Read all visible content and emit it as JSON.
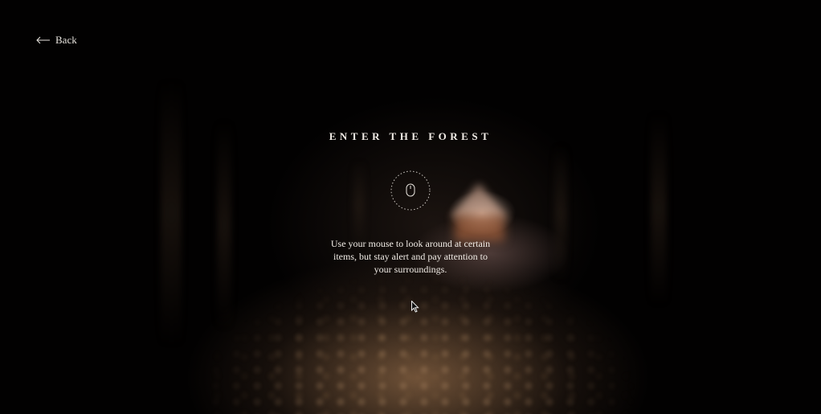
{
  "nav": {
    "back_label": "Back",
    "back_icon": "arrow-left-icon"
  },
  "intro": {
    "title": "ENTER THE FOREST",
    "icon": "mouse-icon",
    "instructions": "Use your mouse to look around at certain items, but stay alert and pay attention to your surroundings."
  },
  "colors": {
    "text": "#f1ece6",
    "background": "#020101"
  }
}
